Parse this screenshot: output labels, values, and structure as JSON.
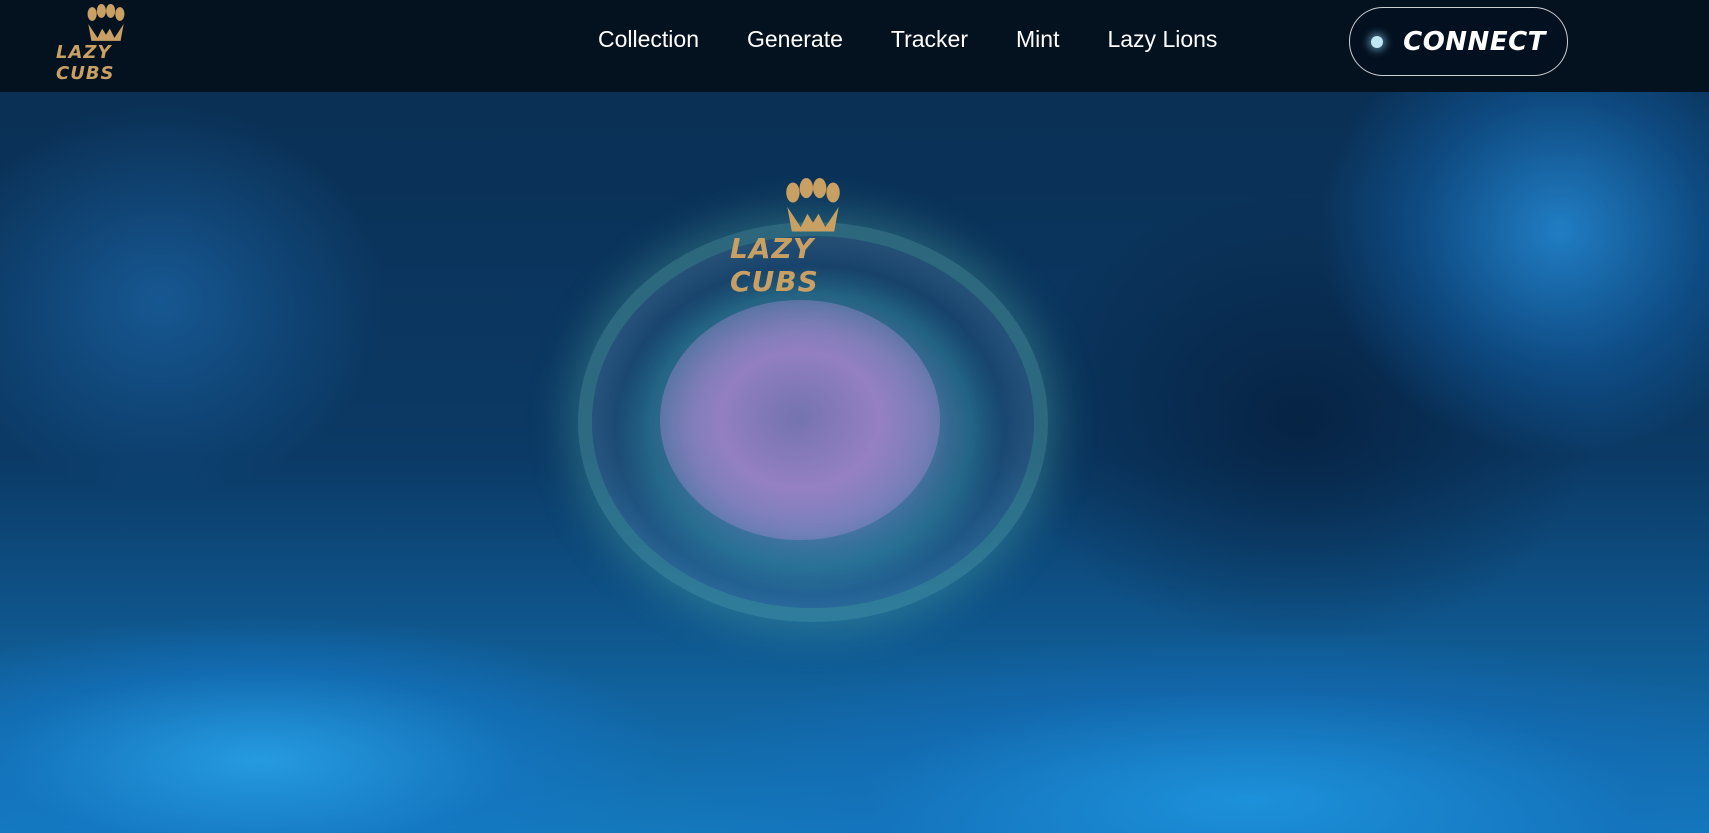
{
  "brand": {
    "name": "LAZY CUBS",
    "accent_color": "#c9a063",
    "icon": "paw-crown-icon"
  },
  "nav": {
    "items": [
      {
        "label": "Collection"
      },
      {
        "label": "Generate"
      },
      {
        "label": "Tracker"
      },
      {
        "label": "Mint"
      },
      {
        "label": "Lazy Lions"
      }
    ]
  },
  "connect": {
    "label": "CONNECT"
  },
  "hero": {
    "logo_text": "LAZY CUBS"
  }
}
